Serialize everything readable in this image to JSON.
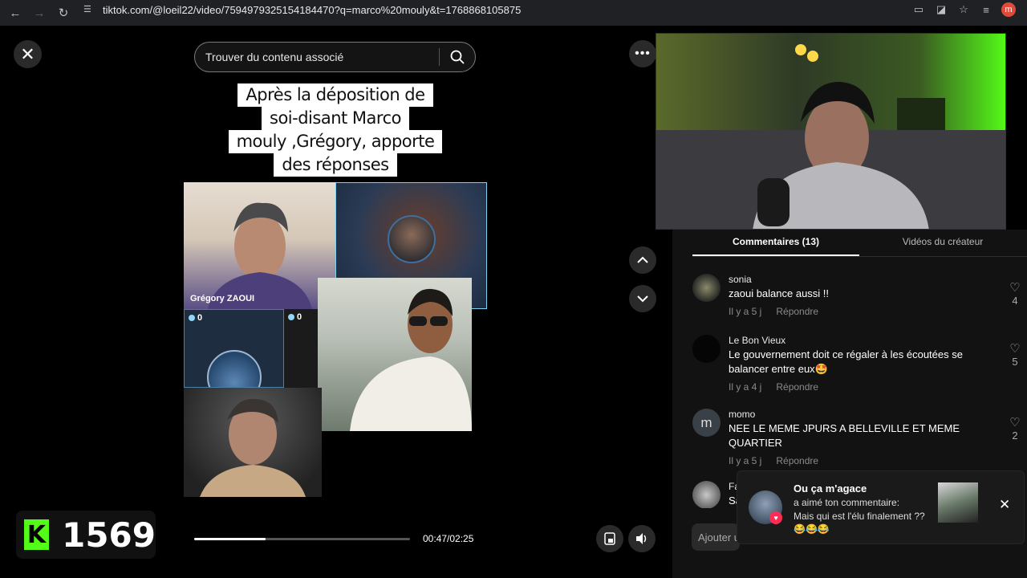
{
  "browser": {
    "url": "tiktok.com/@loeil22/video/7594979325154184470?q=marco%20mouly&t=1768868105875",
    "profile_initial": "m"
  },
  "search": {
    "placeholder": "Trouver du contenu associé"
  },
  "video": {
    "caption_lines": [
      "Après la déposition de",
      "soi-disant Marco",
      "mouly ,Grégory, apporte",
      "des réponses"
    ],
    "tile_name": "Grégory ZAOUI",
    "badge_a": "0",
    "badge_b": "0",
    "time": "00:47/02:25",
    "progress": 0.33
  },
  "stream": {
    "viewer_count": "1569",
    "kick_letter": "K"
  },
  "tabs": {
    "comments": "Commentaires (13)",
    "creator_videos": "Vidéos du créateur"
  },
  "comments": [
    {
      "user": "sonia",
      "text": "zaoui balance aussi !!",
      "time": "Il y a 5 j",
      "reply": "Répondre",
      "likes": "4"
    },
    {
      "user": "Le Bon Vieux",
      "text": "Le gouvernement doit ce régaler à les écoutées se balancer entre eux🤩",
      "time": "Il y a 4 j",
      "reply": "Répondre",
      "likes": "5"
    },
    {
      "user": "momo",
      "avatar_letter": "m",
      "text": "NEE LE MEME JPURS A BELLEVILLE ET MEME QUARTIER",
      "time": "Il y a 5 j",
      "reply": "Répondre",
      "likes": "2"
    },
    {
      "user": "Fa",
      "text": "Sa"
    }
  ],
  "notification": {
    "title": "Ou ça m'agace",
    "subtitle": "a aimé ton commentaire:",
    "body": "Mais qui est l'élu finalement ??😂😂😂"
  },
  "comment_input": {
    "placeholder": "Ajouter u"
  },
  "colors": {
    "kick_green": "#53fc18",
    "tiktok_pink": "#fe2c55"
  }
}
